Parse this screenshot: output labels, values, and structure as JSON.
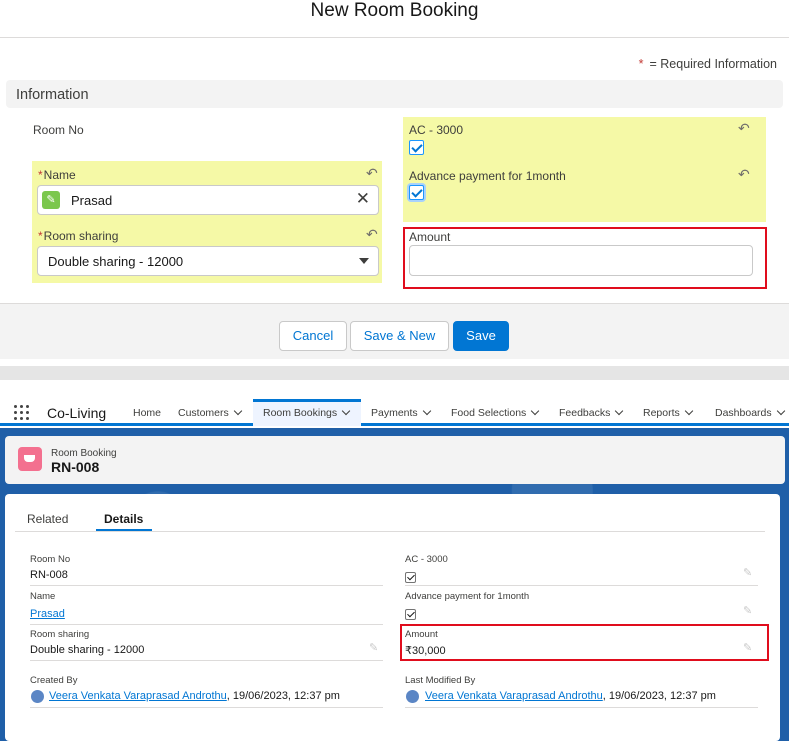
{
  "modal": {
    "title": "New Room Booking",
    "required_note": "= Required Information",
    "required_star": "*",
    "section": "Information",
    "left": {
      "room_no_label": "Room No",
      "name_label": "Name",
      "name_value": "Prasad",
      "room_sharing_label": "Room sharing",
      "room_sharing_value": "Double sharing - 12000"
    },
    "right": {
      "ac_label": "AC - 3000",
      "ac_checked": true,
      "advance_label": "Advance payment for 1month",
      "advance_checked": true,
      "amount_label": "Amount",
      "amount_value": ""
    },
    "buttons": {
      "cancel": "Cancel",
      "save_new": "Save & New",
      "save": "Save"
    },
    "highlight_color": "#f5f9a6",
    "annotation_color": "#e00d1d"
  },
  "nav": {
    "app_name": "Co-Living",
    "items": [
      {
        "label": "Home",
        "has_menu": false
      },
      {
        "label": "Customers",
        "has_menu": true
      },
      {
        "label": "Room Bookings",
        "has_menu": true,
        "active": true
      },
      {
        "label": "Payments",
        "has_menu": true
      },
      {
        "label": "Food Selections",
        "has_menu": true
      },
      {
        "label": "Feedbacks",
        "has_menu": true
      },
      {
        "label": "Reports",
        "has_menu": true
      },
      {
        "label": "Dashboards",
        "has_menu": true
      }
    ]
  },
  "record": {
    "type": "Room Booking",
    "name": "RN-008",
    "tabs": [
      "Related",
      "Details"
    ],
    "active_tab": "Details",
    "fields_left": {
      "room_no_label": "Room No",
      "room_no_value": "RN-008",
      "name_label": "Name",
      "name_value": "Prasad",
      "room_sharing_label": "Room sharing",
      "room_sharing_value": "Double sharing - 12000",
      "created_by_label": "Created By",
      "created_by_user": "Veera Venkata Varaprasad Androthu",
      "created_by_date": ", 19/06/2023, 12:37 pm"
    },
    "fields_right": {
      "ac_label": "AC - 3000",
      "ac_checked": true,
      "advance_label": "Advance payment for 1month",
      "advance_checked": true,
      "amount_label": "Amount",
      "amount_value": "₹30,000",
      "modified_by_label": "Last Modified By",
      "modified_by_user": "Veera Venkata Varaprasad Androthu",
      "modified_by_date": ", 19/06/2023, 12:37 pm"
    }
  }
}
